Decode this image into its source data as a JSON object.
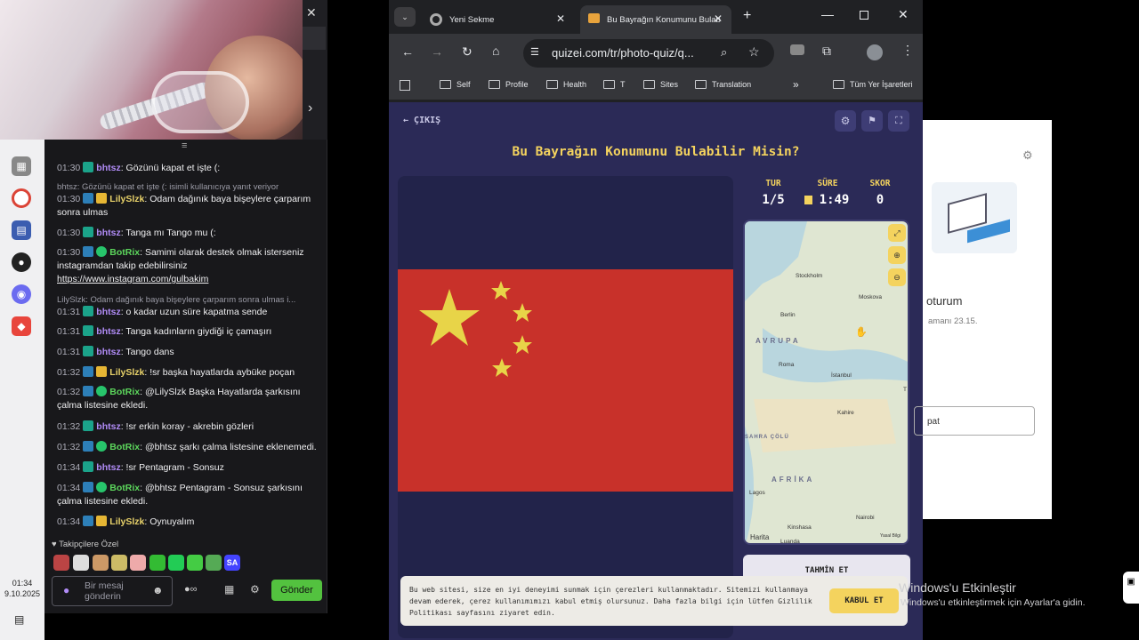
{
  "taskbar": {
    "time": "01:34",
    "date": "9.10.2025"
  },
  "chat": {
    "lines": [
      {
        "t": "01:30",
        "user": "bhtsz",
        "msg": ": Gözünü kapat et işte (:"
      },
      {
        "reply": "bhtsz: Gözünü kapat et işte (: isimli kullanıcıya yanıt veriyor"
      },
      {
        "t": "01:30",
        "user": "LilySlzk",
        "msg": ": Odam dağınık baya bişeylere çarparım sonra ulmas"
      },
      {
        "t": "01:30",
        "user": "bhtsz",
        "msg": ": Tanga mı Tango mu (:"
      },
      {
        "t": "01:30",
        "user": "BotRix",
        "msg": ": Samimi olarak destek olmak isterseniz instagramdan takip edebilirsiniz",
        "link": "https://www.instagram.com/gulbakim"
      },
      {
        "reply": "LilySlzk: Odam dağınık baya bişeylere çarparım sonra ulmas i..."
      },
      {
        "t": "01:31",
        "user": "bhtsz",
        "msg": ": o kadar uzun süre kapatma sende"
      },
      {
        "t": "01:31",
        "user": "bhtsz",
        "msg": ": Tanga kadınların giydiği iç çamaşırı"
      },
      {
        "t": "01:31",
        "user": "bhtsz",
        "msg": ": Tango dans"
      },
      {
        "t": "01:32",
        "user": "LilySlzk",
        "msg": ": !sr başka hayatlarda aybüke poçan"
      },
      {
        "t": "01:32",
        "user": "BotRix",
        "msg": ": @LilySlzk Başka Hayatlarda şarkısını çalma listesine ekledi."
      },
      {
        "t": "01:32",
        "user": "bhtsz",
        "msg": ": !sr erkin koray - akrebin gözleri"
      },
      {
        "t": "01:32",
        "user": "BotRix",
        "msg": ": @bhtsz şarkı çalma listesine eklenemedi."
      },
      {
        "t": "01:34",
        "user": "bhtsz",
        "msg": ": !sr Pentagram - Sonsuz"
      },
      {
        "t": "01:34",
        "user": "BotRix",
        "msg": ": @bhtsz Pentagram - Sonsuz şarkısını çalma listesine ekledi."
      },
      {
        "t": "01:34",
        "user": "LilySlzk",
        "msg": ": Oynuyalım"
      }
    ],
    "followers_label": "Takipçilere Özel",
    "input_placeholder": "Bir mesaj gönderin",
    "send_label": "Gönder"
  },
  "browser": {
    "tab1": "Yeni Sekme",
    "tab2": "Bu Bayrağın Konumunu Bulab",
    "url": "quizei.com/tr/photo-quiz/q...",
    "bookmarks": [
      "Self",
      "Profile",
      "Health",
      "T",
      "Sites",
      "Translation"
    ],
    "all_bookmarks": "Tüm Yer İşaretleri"
  },
  "game": {
    "exit_label": "ÇIKIŞ",
    "title": "Bu Bayrağın Konumunu Bulabilir Misin?",
    "stats": [
      {
        "label": "TUR",
        "value": "1/5"
      },
      {
        "label": "SÜRE",
        "value": "1:49"
      },
      {
        "label": "SKOR",
        "value": "0"
      }
    ],
    "map_labels": {
      "stockholm": "Stockholm",
      "moskova": "Moskova",
      "berlin": "Berlin",
      "avrupa": "AVRUPA",
      "roma": "Roma",
      "istanbul": "İstanbul",
      "kahire": "Kahire",
      "sahra": "SAHRA ÇÖLÜ",
      "afrika": "AFRİKA",
      "lagos": "Lagos",
      "kinshasa": "Kinshasa",
      "luanda": "Luanda",
      "nairobi": "Nairobi",
      "harita": "Harita",
      "yasal": "Yasal Bilgi",
      "t": "T"
    },
    "guess_label": "TAHMİN ET",
    "cookie_text": "Bu web sitesi, size en iyi deneyimi sunmak için çerezleri kullanmaktadır. Sitemizi kullanmaya devam ederek, çerez kullanımımızı kabul etmiş olursunuz. Daha fazla bilgi için lütfen Gizlilik Politikası sayfasını ziyaret edin.",
    "cookie_btn": "KABUL ET"
  },
  "dialog": {
    "title": "oturum",
    "subtitle": "amanı 23.15.",
    "button": "pat"
  },
  "watermark": {
    "line1": "Windows'u Etkinleştir",
    "line2": "Windows'u etkinleştirmek için Ayarlar'a gidin."
  },
  "colors": {
    "accent": "#f4d35e",
    "page_bg": "#2b2a57",
    "flag_red": "#c8312a",
    "send_green": "#53c23f"
  }
}
